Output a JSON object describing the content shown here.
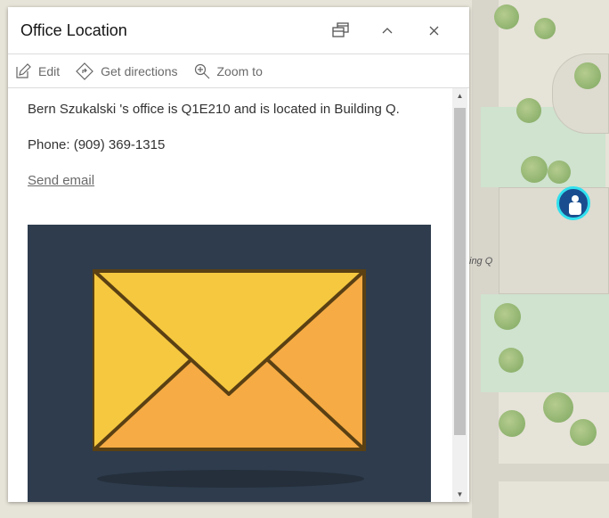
{
  "map": {
    "building_label": "ing Q"
  },
  "popup": {
    "title": "Office Location",
    "dock_label": "Dock",
    "collapse_label": "Collapse",
    "close_label": "Close",
    "actions": [
      {
        "label": "Edit"
      },
      {
        "label": "Get directions"
      },
      {
        "label": "Zoom to"
      }
    ],
    "description": "Bern Szukalski 's office is Q1E210 and is located in Building Q.",
    "phone": "Phone: (909) 369-1315",
    "email_link": "Send email"
  },
  "colors": {
    "image_bg": "#2e3c4d",
    "envelope_light": "#f5c83f",
    "envelope_dark": "#f6ab44",
    "marker": "#1a4d8f",
    "marker_ring": "#31e0ee"
  }
}
